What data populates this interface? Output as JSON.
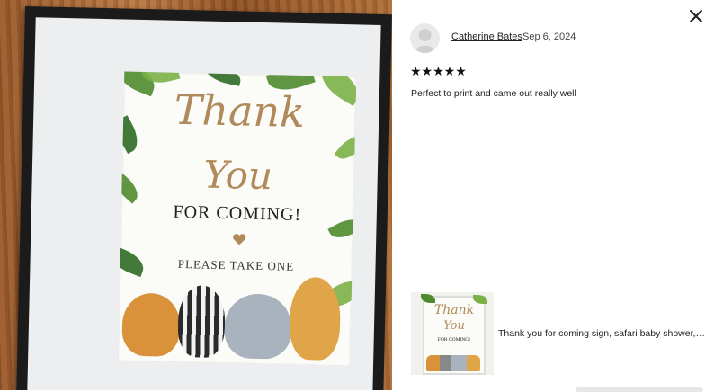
{
  "review": {
    "reviewer_name": "Catherine Bates",
    "date": "Sep 6, 2024",
    "stars": "★★★★★",
    "rating": 5,
    "text": "Perfect to print and came out really well"
  },
  "photo": {
    "sign_line1": "Thank",
    "sign_line2": "You",
    "sign_line3": "FOR COMING!",
    "sign_line4": "PLEASE TAKE ONE"
  },
  "listing": {
    "title": "Thank you for coming sign, safari baby shower, f...",
    "thumb_line1": "Thank",
    "thumb_line2": "You",
    "thumb_line3": "FOR COMING!"
  },
  "icons": {
    "close": "close-icon",
    "avatar": "user-silhouette-icon"
  },
  "colors": {
    "sign_gold": "#b08a5a",
    "leaf_green": "#4f8b2d",
    "frame_black": "#1b1b1b"
  }
}
